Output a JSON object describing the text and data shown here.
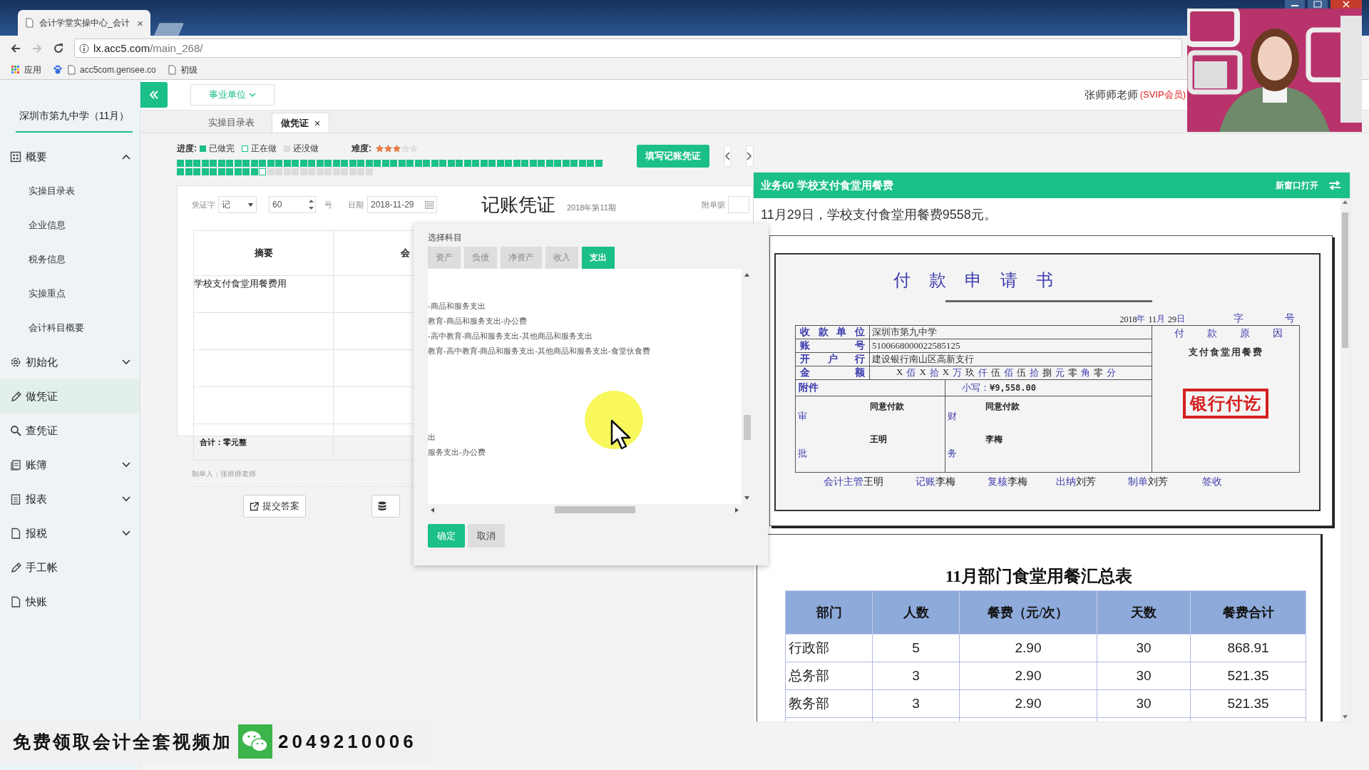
{
  "browser": {
    "tab_title": "会计学堂实操中心_会计",
    "tab_close": "×",
    "url_host": "lx.acc5.com",
    "url_path": "/main_268/",
    "bookmarks": [
      {
        "label": "应用",
        "kind": "apps"
      },
      {
        "label": "acc5com.gensee.co",
        "kind": "site"
      },
      {
        "label": "初级",
        "kind": "page"
      }
    ]
  },
  "sidebar": {
    "company": "深圳市第九中学（11月）",
    "items": [
      {
        "label": "概要",
        "expanded": true,
        "selected": false,
        "children": [
          {
            "label": "实操目录表",
            "selected": false
          },
          {
            "label": "企业信息",
            "selected": false
          },
          {
            "label": "税务信息",
            "selected": false
          },
          {
            "label": "实操重点",
            "selected": false
          },
          {
            "label": "会计科目概要",
            "selected": false
          }
        ]
      },
      {
        "label": "初始化",
        "expanded": false,
        "selected": false
      },
      {
        "label": "做凭证",
        "selected": true
      },
      {
        "label": "查凭证",
        "selected": false
      },
      {
        "label": "账簿",
        "expanded": false,
        "selected": false
      },
      {
        "label": "报表",
        "expanded": false,
        "selected": false
      },
      {
        "label": "报税",
        "expanded": false,
        "selected": false
      },
      {
        "label": "手工帐",
        "selected": false
      },
      {
        "label": "快账",
        "selected": false
      }
    ]
  },
  "header": {
    "unit_dropdown": "事业单位",
    "user_name": "张师师老师",
    "user_badge": "(SVIP会员)"
  },
  "tabs": [
    {
      "label": "实操目录表",
      "selected": false
    },
    {
      "label": "做凭证",
      "selected": true,
      "close": "×"
    }
  ],
  "progress": {
    "label": "进度:",
    "legend": [
      {
        "label": "已做完",
        "kind": "done"
      },
      {
        "label": "正在做",
        "kind": "current"
      },
      {
        "label": "还没做",
        "kind": "todo"
      }
    ],
    "difficulty_label": "难度:",
    "stars": 3,
    "tasks": [
      {
        "kind": "done"
      },
      {
        "kind": "done"
      },
      {
        "kind": "done"
      },
      {
        "kind": "done"
      },
      {
        "kind": "done"
      },
      {
        "kind": "done"
      },
      {
        "kind": "done"
      },
      {
        "kind": "done"
      },
      {
        "kind": "done"
      },
      {
        "kind": "done"
      },
      {
        "kind": "done"
      },
      {
        "kind": "done"
      },
      {
        "kind": "done"
      },
      {
        "kind": "done"
      },
      {
        "kind": "done"
      },
      {
        "kind": "done"
      },
      {
        "kind": "done"
      },
      {
        "kind": "done"
      },
      {
        "kind": "done"
      },
      {
        "kind": "done"
      },
      {
        "kind": "done"
      },
      {
        "kind": "done"
      },
      {
        "kind": "done"
      },
      {
        "kind": "done"
      },
      {
        "kind": "done"
      },
      {
        "kind": "done"
      },
      {
        "kind": "done"
      },
      {
        "kind": "done"
      },
      {
        "kind": "done"
      },
      {
        "kind": "done"
      },
      {
        "kind": "done"
      },
      {
        "kind": "done"
      },
      {
        "kind": "done"
      },
      {
        "kind": "done"
      },
      {
        "kind": "done"
      },
      {
        "kind": "done"
      },
      {
        "kind": "done"
      },
      {
        "kind": "done"
      },
      {
        "kind": "done"
      },
      {
        "kind": "done"
      },
      {
        "kind": "done"
      },
      {
        "kind": "done"
      },
      {
        "kind": "done"
      },
      {
        "kind": "done"
      },
      {
        "kind": "done"
      },
      {
        "kind": "done"
      },
      {
        "kind": "done"
      },
      {
        "kind": "done"
      },
      {
        "kind": "done"
      },
      {
        "kind": "done"
      },
      {
        "kind": "done"
      },
      {
        "kind": "done"
      },
      {
        "kind": "done"
      },
      {
        "kind": "done"
      },
      {
        "kind": "done"
      },
      {
        "kind": "done"
      },
      {
        "kind": "done"
      },
      {
        "kind": "done"
      },
      {
        "kind": "done"
      },
      {
        "kind": "done"
      },
      {
        "kind": "done"
      },
      {
        "kind": "done"
      },
      {
        "kind": "current"
      },
      {
        "kind": "todo"
      },
      {
        "kind": "todo"
      },
      {
        "kind": "todo"
      },
      {
        "kind": "todo"
      },
      {
        "kind": "todo"
      },
      {
        "kind": "todo"
      },
      {
        "kind": "todo"
      },
      {
        "kind": "todo"
      },
      {
        "kind": "todo"
      },
      {
        "kind": "todo"
      },
      {
        "kind": "todo"
      },
      {
        "kind": "todo"
      },
      {
        "kind": "todo"
      }
    ],
    "fill_button": "填写记账凭证"
  },
  "voucher": {
    "word_label": "凭证字",
    "word": "记",
    "number": "60",
    "number_suffix": "号",
    "date_label": "日期",
    "date": "2018-11-29",
    "title": "记账凭证",
    "period": "2018年第11期",
    "attachments_label": "附单据",
    "columns": [
      "摘要",
      "会"
    ],
    "rows": [
      {
        "summary": "学校支付食堂用餐费用"
      }
    ],
    "total": "合计：零元整",
    "maker": "制单人：张师师老师",
    "submit_button": "提交答案"
  },
  "subject_popup": {
    "title": "选择科目",
    "tabs": [
      {
        "label": "资产",
        "selected": false
      },
      {
        "label": "负债",
        "selected": false
      },
      {
        "label": "净资产",
        "selected": false
      },
      {
        "label": "收入",
        "selected": false
      },
      {
        "label": "支出",
        "selected": true
      }
    ],
    "entry_groups": [
      [
        "-商品和服务支出",
        "教育-商品和服务支出-办公费",
        "-高中教育-商品和服务支出-其他商品和服务支出",
        "教育-高中教育-商品和服务支出-其他商品和服务支出-食堂伙食费"
      ],
      [
        "出",
        "服务支出-办公费"
      ]
    ],
    "ok_button": "确定",
    "cancel_button": "取消"
  },
  "task_panel": {
    "title": "业务60 学校支付食堂用餐费",
    "open_new": "新窗口打开",
    "description": "11月29日，学校支付食堂用餐费9558元。",
    "payment_form": {
      "title": "付款申请书",
      "date": [
        {
          "text": "2018",
          "kind": "value"
        },
        {
          "text": "年",
          "kind": "label"
        },
        {
          "text": "11",
          "kind": "value"
        },
        {
          "text": "月",
          "kind": "label"
        },
        {
          "text": "29",
          "kind": "value"
        },
        {
          "text": "日",
          "kind": "label"
        }
      ],
      "number_labels": [
        "字",
        "号"
      ],
      "rows": [
        {
          "label": "收款单位",
          "value": "深圳市第九中学"
        },
        {
          "label": "账号",
          "value": "5100668000022585125"
        },
        {
          "label": "开户行",
          "value": "建设银行南山区高新支行"
        }
      ],
      "amount_label": "金额",
      "amount": [
        {
          "text": "X",
          "kind": "value"
        },
        {
          "text": "佰",
          "kind": "label"
        },
        {
          "text": "X",
          "kind": "value"
        },
        {
          "text": "拾",
          "kind": "label"
        },
        {
          "text": "X",
          "kind": "value"
        },
        {
          "text": "万",
          "kind": "label"
        },
        {
          "text": "玖",
          "kind": "value"
        },
        {
          "text": "仟",
          "kind": "label"
        },
        {
          "text": "伍",
          "kind": "value"
        },
        {
          "text": "佰",
          "kind": "label"
        },
        {
          "text": "伍",
          "kind": "value"
        },
        {
          "text": "拾",
          "kind": "label"
        },
        {
          "text": "捌",
          "kind": "value"
        },
        {
          "text": "元",
          "kind": "label"
        },
        {
          "text": "零",
          "kind": "value"
        },
        {
          "text": "角",
          "kind": "label"
        },
        {
          "text": "零",
          "kind": "value"
        },
        {
          "text": "分",
          "kind": "label"
        }
      ],
      "attachment_label": "附件",
      "figures_label": "小写：",
      "figures": "¥9,558.00",
      "approve_label": "审批",
      "approve_note": "同意付款",
      "approve_name": "王明",
      "finance_label": "财务",
      "finance_note": "同意付款",
      "finance_name": "李梅",
      "reason_label": "付款原因",
      "reason": "支付食堂用餐费",
      "stamp": "银行付讫",
      "signatures": [
        {
          "label": "会计主管",
          "name": "王明"
        },
        {
          "label": "记账",
          "name": "李梅"
        },
        {
          "label": "复核",
          "name": "李梅"
        },
        {
          "label": "出纳",
          "name": "刘芳"
        },
        {
          "label": "制单",
          "name": "刘芳"
        },
        {
          "label": "签收"
        }
      ]
    },
    "summary_table": {
      "title": "11月部门食堂用餐汇总表",
      "columns": [
        "部门",
        "人数",
        "餐费（元/次）",
        "天数",
        "餐费合计"
      ],
      "rows": [
        [
          "行政部",
          "5",
          "2.90",
          "30",
          "868.91"
        ],
        [
          "总务部",
          "3",
          "2.90",
          "30",
          "521.35"
        ],
        [
          "教务部",
          "3",
          "2.90",
          "30",
          "521.35"
        ]
      ]
    }
  },
  "promo": {
    "text": "免费领取会计全套视频加",
    "number": "2049210006"
  }
}
